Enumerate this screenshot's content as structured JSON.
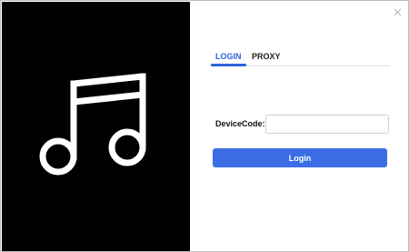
{
  "colors": {
    "accent": "#3b6ee6",
    "tab_active": "#2f63dc",
    "left_panel": "#000000"
  },
  "window": {
    "close_icon": "close-icon"
  },
  "left_panel": {
    "logo_icon": "music-note-icon"
  },
  "tabs": [
    {
      "label": "LOGIN",
      "active": true
    },
    {
      "label": "PROXY",
      "active": false
    }
  ],
  "form": {
    "device_code_label": "DeviceCode:",
    "device_code_value": "",
    "device_code_placeholder": "",
    "login_button_label": "Login"
  }
}
